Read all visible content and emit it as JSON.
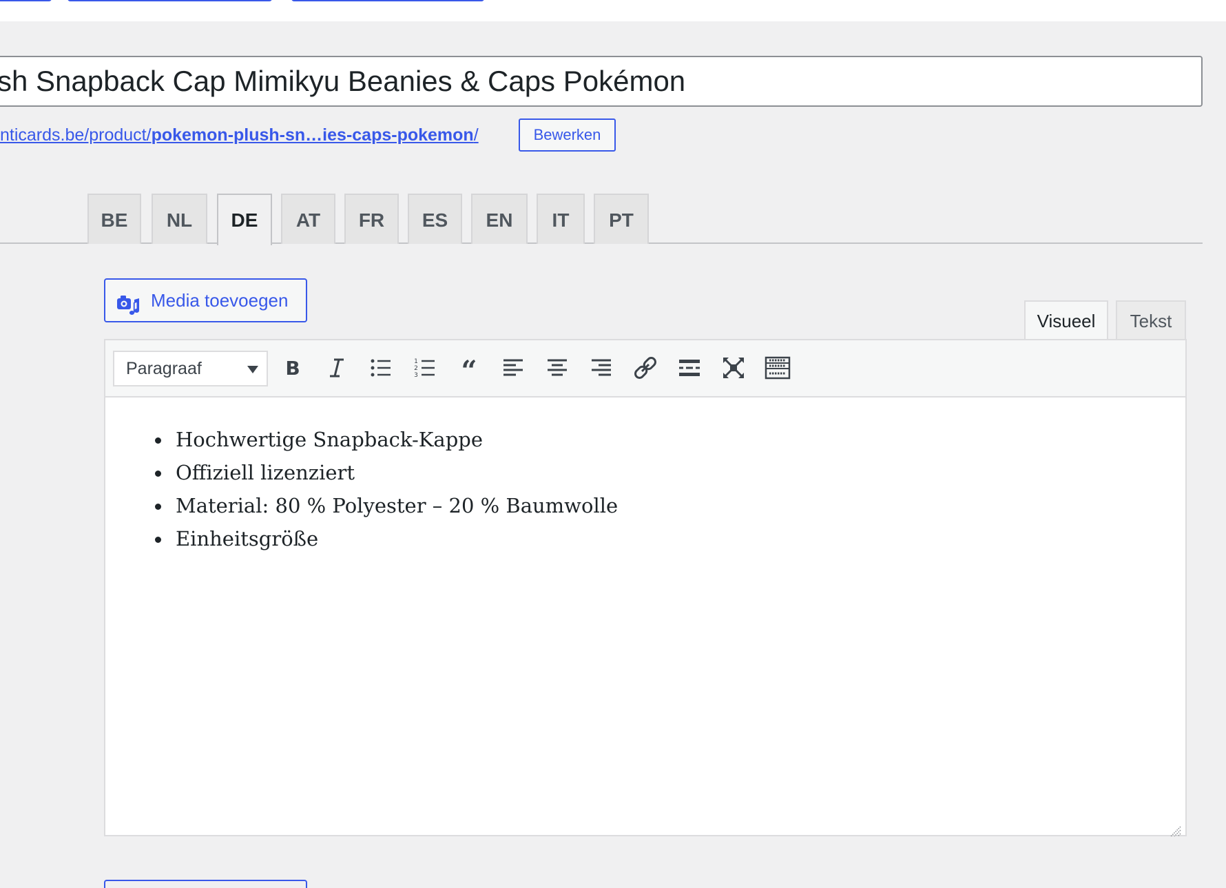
{
  "post_title": "sh Snapback Cap Mimikyu Beanies & Caps Pokémon",
  "permalink": {
    "base": "nticards.be/product/",
    "slug": "pokemon-plush-sn…ies-caps-pokemon",
    "trailing": "/",
    "edit_label": "Bewerken"
  },
  "language_tabs": [
    {
      "label": "BE"
    },
    {
      "label": "NL"
    },
    {
      "label": "DE"
    },
    {
      "label": "AT"
    },
    {
      "label": "FR"
    },
    {
      "label": "ES"
    },
    {
      "label": "EN"
    },
    {
      "label": "IT"
    },
    {
      "label": "PT"
    }
  ],
  "active_language": "DE",
  "media_button": {
    "label": "Media toevoegen",
    "icon": "media-add-icon"
  },
  "editor_modes": {
    "visual": "Visueel",
    "text": "Tekst",
    "active": "Visueel"
  },
  "toolbar": {
    "format_select": "Paragraaf",
    "buttons": [
      "bold-icon",
      "italic-icon",
      "bullet-list-icon",
      "numbered-list-icon",
      "blockquote-icon",
      "align-left-icon",
      "align-center-icon",
      "align-right-icon",
      "link-icon",
      "read-more-icon",
      "fullscreen-icon",
      "toolbar-toggle-icon"
    ]
  },
  "content": {
    "list_items": [
      "Hochwertige Snapback-Kappe",
      "Offiziell lizenziert",
      "Material: 80 % Polyester – 20 % Baumwolle",
      "Einheitsgröße"
    ]
  },
  "colors": {
    "accent": "#3858e9",
    "background": "#f0f0f1",
    "text": "#1d2327",
    "border": "#dcdcde"
  }
}
